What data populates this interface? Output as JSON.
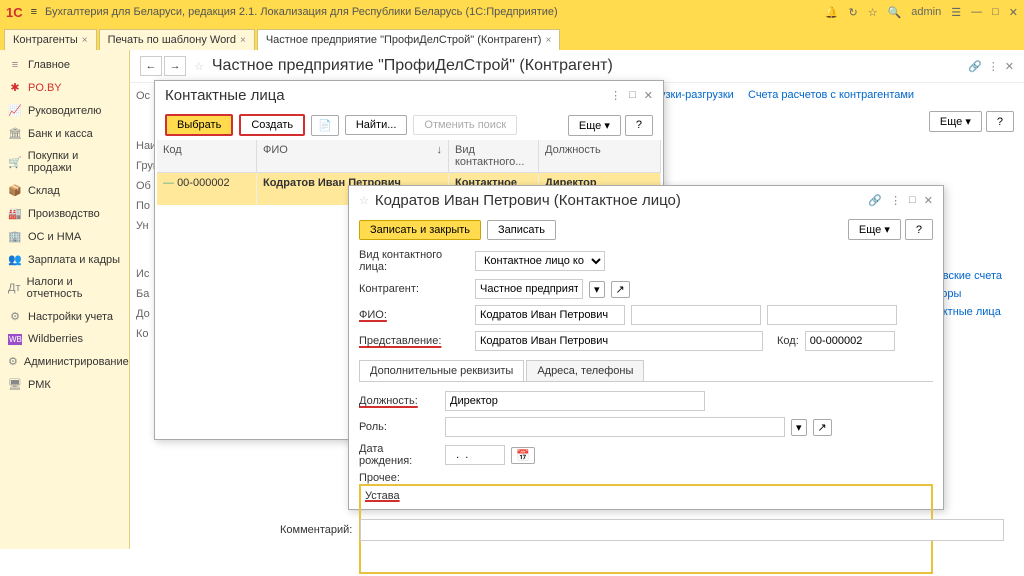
{
  "titlebar": {
    "logo": "1С",
    "title": "Бухгалтерия для Беларуси, редакция 2.1. Локализация для Республики Беларусь  (1С:Предприятие)",
    "user": "admin"
  },
  "tabs": [
    {
      "label": "Контрагенты",
      "active": false
    },
    {
      "label": "Печать по шаблону Word",
      "active": false
    },
    {
      "label": "Частное предприятие \"ПрофиДелСтрой\" (Контрагент)",
      "active": true
    }
  ],
  "sidebar": [
    {
      "icon": "≡",
      "label": "Главное"
    },
    {
      "icon": "✱",
      "label": "PO.BY",
      "active": true
    },
    {
      "icon": "📈",
      "label": "Руководителю"
    },
    {
      "icon": "🏛",
      "label": "Банк и касса"
    },
    {
      "icon": "🛒",
      "label": "Покупки и продажи"
    },
    {
      "icon": "📦",
      "label": "Склад"
    },
    {
      "icon": "🏭",
      "label": "Производство"
    },
    {
      "icon": "🏢",
      "label": "ОС и НМА"
    },
    {
      "icon": "👥",
      "label": "Зарплата и кадры"
    },
    {
      "icon": "Дт",
      "label": "Налоги и отчетность"
    },
    {
      "icon": "⚙",
      "label": "Настройки учета"
    },
    {
      "icon": "WB",
      "label": "Wildberries"
    },
    {
      "icon": "⚙",
      "label": "Администрирование"
    },
    {
      "icon": "🖥",
      "label": "РМК"
    }
  ],
  "page": {
    "title": "Частное предприятие \"ПрофиДелСтрой\" (Контрагент)",
    "more_btn": "Еще",
    "help": "?",
    "link1": "узки-разгрузки",
    "link2": "Счета расчетов с контрагентами",
    "comment_label": "Комментарий:",
    "side_links": [
      "анковские счета",
      "оговоры",
      "онтактные лица"
    ],
    "trunc_labels": [
      "Ос",
      "Наим",
      "Груп",
      "Об",
      "По",
      "Ун",
      "Ис",
      "Ба",
      "До",
      "Ко"
    ]
  },
  "dialog1": {
    "title": "Контактные лица",
    "btn_select": "Выбрать",
    "btn_create": "Создать",
    "btn_find": "Найти...",
    "btn_cancel": "Отменить поиск",
    "btn_more": "Еще",
    "btn_help": "?",
    "columns": [
      "Код",
      "ФИО",
      "Вид контактного...",
      "Должность"
    ],
    "row": {
      "code": "00-000002",
      "fio": "Кодратов Иван Петрович",
      "type": "Контактное ли...",
      "position": "Директор"
    }
  },
  "dialog2": {
    "title": "Кодратов Иван Петрович (Контактное лицо)",
    "btn_save_close": "Записать и закрыть",
    "btn_save": "Записать",
    "btn_more": "Еще",
    "btn_help": "?",
    "labels": {
      "type": "Вид контактного лица:",
      "counterparty": "Контрагент:",
      "fio": "ФИО:",
      "repr": "Представление:",
      "code": "Код:",
      "position": "Должность:",
      "role": "Роль:",
      "birthdate": "Дата рождения:",
      "other": "Прочее:"
    },
    "values": {
      "type": "Контактное лицо контраген",
      "counterparty": "Частное предприятие \"",
      "fio": "Кодратов Иван Петрович",
      "repr": "Кодратов Иван Петрович",
      "code": "00-000002",
      "position": "Директор",
      "role": "",
      "birthdate": "  .  .",
      "other": "Устава"
    },
    "card_tabs": [
      "Дополнительные реквизиты",
      "Адреса, телефоны"
    ]
  }
}
